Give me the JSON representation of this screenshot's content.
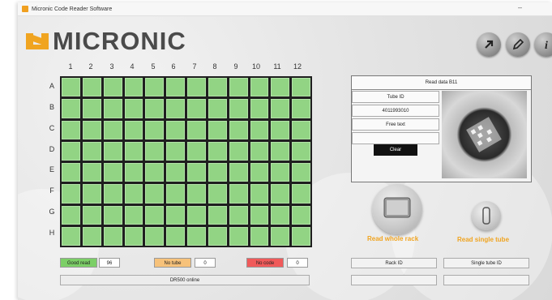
{
  "window": {
    "title": "Micronic Code Reader Software",
    "minimize": "–"
  },
  "logo": {
    "text": "MICRONIC"
  },
  "toolbar": {
    "info_glyph": "i"
  },
  "grid": {
    "columns": [
      "1",
      "2",
      "3",
      "4",
      "5",
      "6",
      "7",
      "8",
      "9",
      "10",
      "11",
      "12"
    ],
    "rows": [
      "A",
      "B",
      "C",
      "D",
      "E",
      "F",
      "G",
      "H"
    ],
    "well_color": "#92d484"
  },
  "read_panel": {
    "header": "Read data B11",
    "tube_id_label": "Tube ID",
    "tube_id_value": "4011993010",
    "free_text_label": "Free text",
    "free_text_value": "",
    "clear_button": "Clear"
  },
  "actions": {
    "read_rack": "Read whole rack",
    "read_single": "Read single tube"
  },
  "status": {
    "good_read_label": "Good read",
    "good_read_count": "96",
    "good_read_color": "#7ccf67",
    "no_tube_label": "No tube",
    "no_tube_count": "0",
    "no_tube_color": "#f7c27a",
    "no_code_label": "No code",
    "no_code_count": "0",
    "no_code_color": "#f05a5a",
    "device_status": "DR500 online"
  },
  "fields": {
    "rack_id_label": "Rack ID",
    "rack_id_value": "",
    "single_tube_label": "Single tube ID",
    "single_tube_value": ""
  }
}
